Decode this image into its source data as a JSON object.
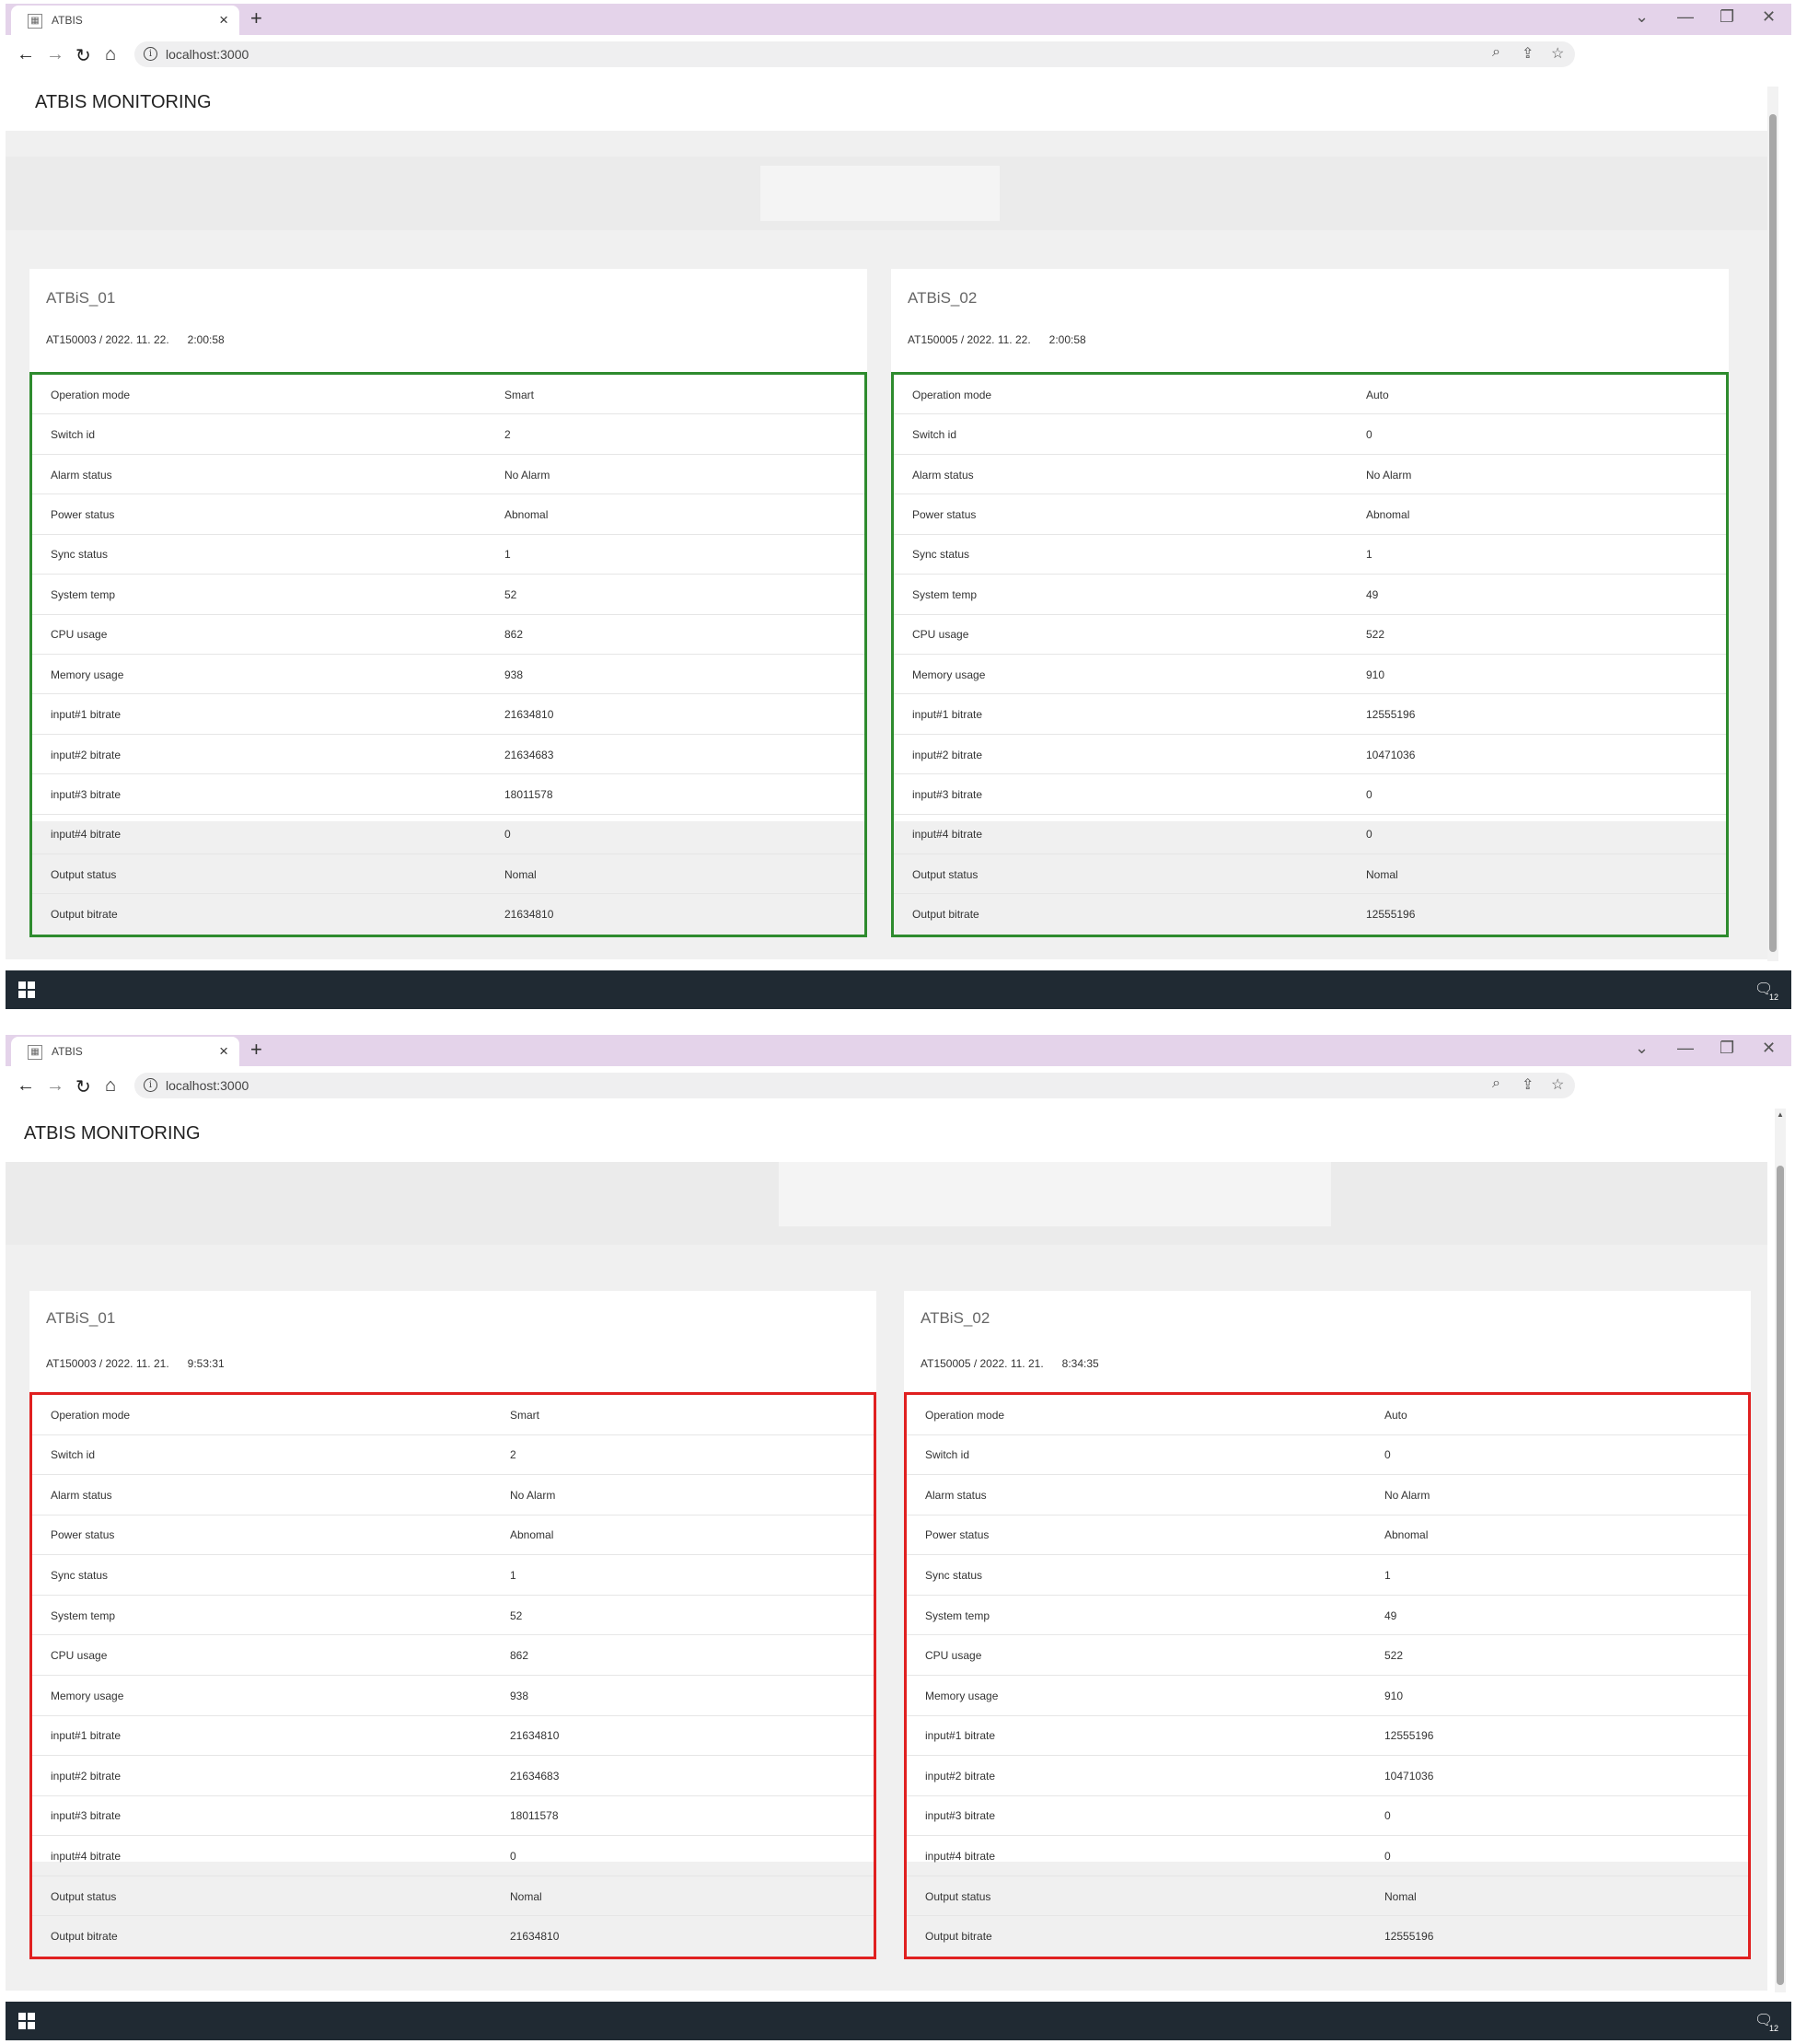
{
  "browser": {
    "tab_title": "ATBIS",
    "favicon_glyph": "▦",
    "url": "localhost:3000",
    "new_tab_glyph": "+",
    "tab_close_glyph": "×",
    "window_controls": [
      "⌄",
      "—",
      "❐",
      "✕"
    ],
    "nav": {
      "back": "←",
      "forward": "→",
      "reload": "↻",
      "home": "⌂"
    },
    "info_glyph": "i",
    "omni_icons": [
      "⌕",
      "⇪",
      "☆"
    ]
  },
  "app_title": "ATBIS MONITORING",
  "row_labels": [
    "Operation mode",
    "Switch id",
    "Alarm status",
    "Power status",
    "Sync status",
    "System temp",
    "CPU usage",
    "Memory usage",
    "input#1 bitrate",
    "input#2 bitrate",
    "input#3 bitrate",
    "input#4 bitrate",
    "Output status",
    "Output bitrate"
  ],
  "screenshots": [
    {
      "border_color": "#2e8b2e",
      "devices": [
        {
          "name": "ATBiS_01",
          "subtitle": "AT150003 / 2022. 11. 22.      2:00:58",
          "values": [
            "Smart",
            "2",
            "No Alarm",
            "Abnomal",
            "1",
            "52",
            "862",
            "938",
            "21634810",
            "21634683",
            "18011578",
            "0",
            "Nomal",
            "21634810"
          ]
        },
        {
          "name": "ATBiS_02",
          "subtitle": "AT150005 / 2022. 11. 22.      2:00:58",
          "values": [
            "Auto",
            "0",
            "No Alarm",
            "Abnomal",
            "1",
            "49",
            "522",
            "910",
            "12555196",
            "10471036",
            "0",
            "0",
            "Nomal",
            "12555196"
          ]
        }
      ]
    },
    {
      "border_color": "#e02020",
      "devices": [
        {
          "name": "ATBiS_01",
          "subtitle": "AT150003 / 2022. 11. 21.      9:53:31",
          "values": [
            "Smart",
            "2",
            "No Alarm",
            "Abnomal",
            "1",
            "52",
            "862",
            "938",
            "21634810",
            "21634683",
            "18011578",
            "0",
            "Nomal",
            "21634810"
          ]
        },
        {
          "name": "ATBiS_02",
          "subtitle": "AT150005 / 2022. 11. 21.      8:34:35",
          "values": [
            "Auto",
            "0",
            "No Alarm",
            "Abnomal",
            "1",
            "49",
            "522",
            "910",
            "12555196",
            "10471036",
            "0",
            "0",
            "Nomal",
            "12555196"
          ]
        }
      ]
    }
  ],
  "taskbar": {
    "notification_glyph": "🗨",
    "notification_count": "12"
  },
  "colors": {
    "tabbar": "#e4d3ea",
    "taskbar": "#202a33",
    "ok_border": "#2e8b2e",
    "alert_border": "#e02020"
  }
}
